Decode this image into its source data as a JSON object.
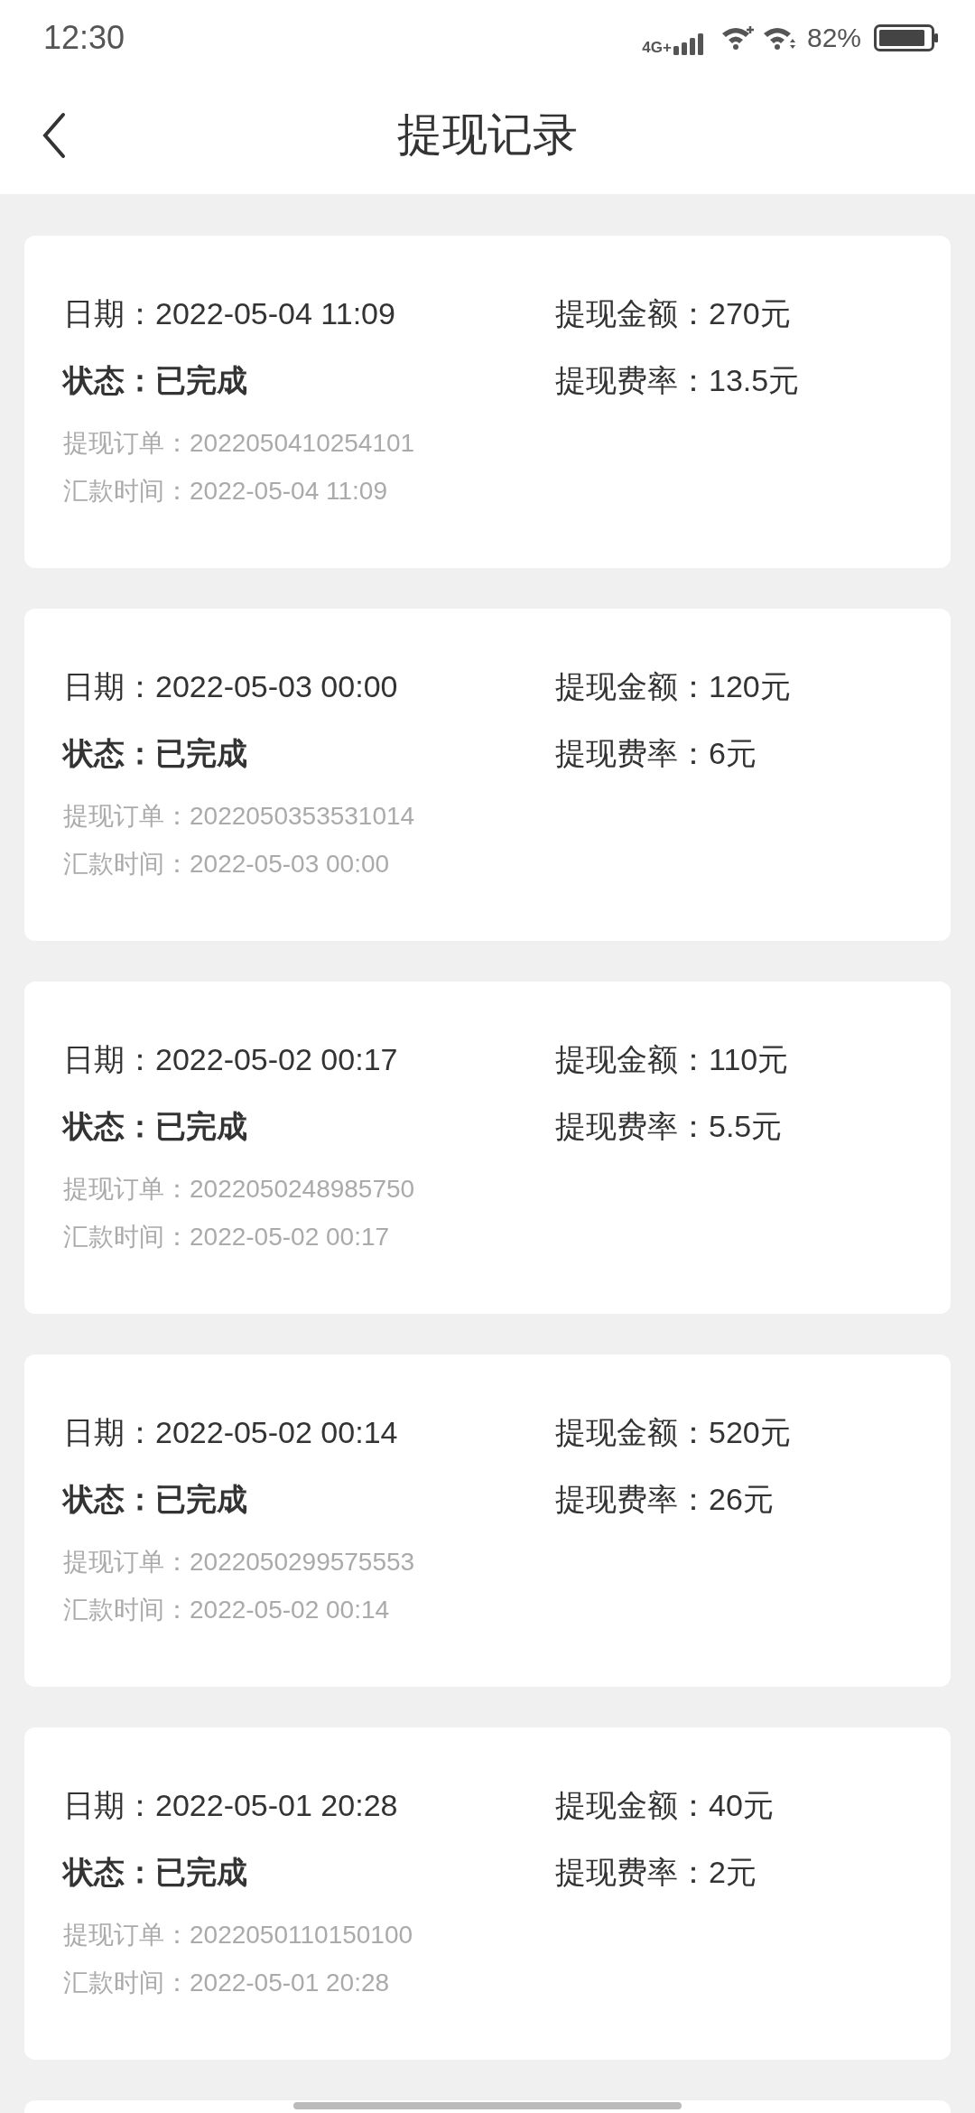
{
  "status_bar": {
    "time": "12:30",
    "network": "4G+",
    "battery": "82%"
  },
  "header": {
    "title": "提现记录"
  },
  "records": [
    {
      "date": "日期：2022-05-04 11:09",
      "amount": "提现金额：270元",
      "status": "状态：已完成",
      "fee": "提现费率：13.5元",
      "order": "提现订单：2022050410254101",
      "remit_time": "汇款时间：2022-05-04 11:09"
    },
    {
      "date": "日期：2022-05-03 00:00",
      "amount": "提现金额：120元",
      "status": "状态：已完成",
      "fee": "提现费率：6元",
      "order": "提现订单：2022050353531014",
      "remit_time": "汇款时间：2022-05-03 00:00"
    },
    {
      "date": "日期：2022-05-02 00:17",
      "amount": "提现金额：110元",
      "status": "状态：已完成",
      "fee": "提现费率：5.5元",
      "order": "提现订单：2022050248985750",
      "remit_time": "汇款时间：2022-05-02 00:17"
    },
    {
      "date": "日期：2022-05-02 00:14",
      "amount": "提现金额：520元",
      "status": "状态：已完成",
      "fee": "提现费率：26元",
      "order": "提现订单：2022050299575553",
      "remit_time": "汇款时间：2022-05-02 00:14"
    },
    {
      "date": "日期：2022-05-01 20:28",
      "amount": "提现金额：40元",
      "status": "状态：已完成",
      "fee": "提现费率：2元",
      "order": "提现订单：2022050110150100",
      "remit_time": "汇款时间：2022-05-01 20:28"
    }
  ]
}
